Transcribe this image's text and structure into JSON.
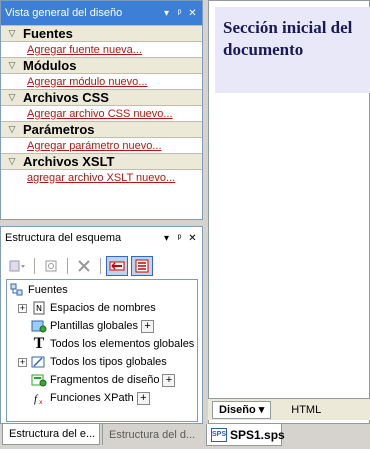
{
  "overview": {
    "title": "Vista general del diseño",
    "controls": [
      "▾",
      "ᵖ",
      "✕"
    ],
    "sections": [
      {
        "label": "Fuentes",
        "link": "Agregar fuente nueva..."
      },
      {
        "label": "Módulos",
        "link": "Agregar módulo nuevo..."
      },
      {
        "label": "Archivos CSS",
        "link": "Agregar archivo CSS nuevo..."
      },
      {
        "label": "Parámetros",
        "link": "Agregar parámetro nuevo..."
      },
      {
        "label": "Archivos XSLT",
        "link": "agregar archivo XSLT nuevo..."
      }
    ]
  },
  "schema": {
    "title": "Estructura del esquema",
    "controls": [
      "▾",
      "ᵖ",
      "✕"
    ],
    "tree": {
      "root": "Fuentes",
      "items": [
        {
          "label": "Espacios de nombres",
          "icon": "namespace-icon",
          "expander": "+"
        },
        {
          "label": "Plantillas globales",
          "icon": "global-templates-icon",
          "expander": ""
        },
        {
          "label": "Todos los elementos globales",
          "icon": "text-element-icon",
          "expander": ""
        },
        {
          "label": "Todos los tipos globales",
          "icon": "global-types-icon",
          "expander": "+"
        },
        {
          "label": "Fragmentos de diseño",
          "icon": "design-fragments-icon",
          "expander": ""
        },
        {
          "label": "Funciones XPath",
          "icon": "xpath-function-icon",
          "expander": ""
        }
      ]
    }
  },
  "bottom_tabs": [
    "Estructura del e...",
    "Estructura del d..."
  ],
  "document": {
    "header_line1": "Sección inicial del",
    "header_line2": "documento",
    "view_tabs": [
      "Diseño ▾",
      "HTML"
    ],
    "file_tab": "SPS1.sps"
  },
  "colors": {
    "active_title": "#3d7fd6",
    "link_red": "#b01818",
    "section_bg": "#ece9d8",
    "doc_header_bg": "#e8e8f8"
  }
}
